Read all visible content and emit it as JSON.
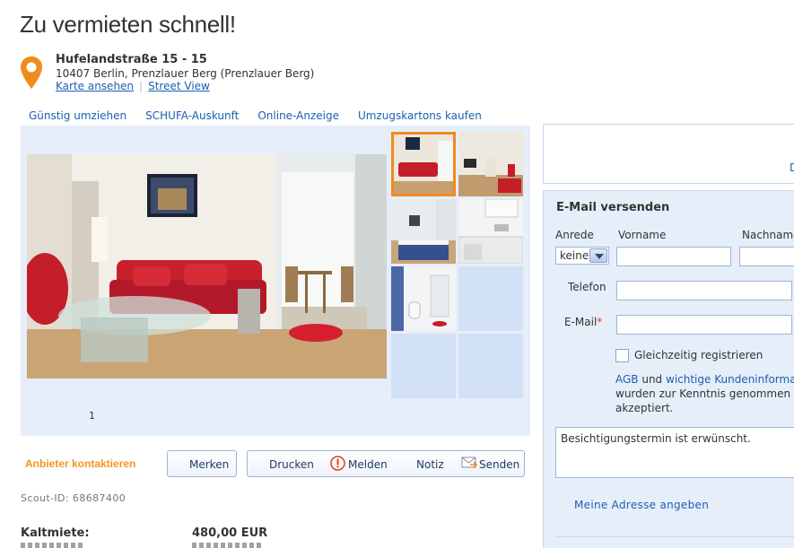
{
  "page": {
    "title": "Zu vermieten schnell!",
    "address": {
      "street": "Hufelandstraße 15 - 15",
      "city_line": "10407 Berlin, Prenzlauer Berg (Prenzlauer Berg)",
      "map_link": "Karte ansehen",
      "street_view_link": "Street View"
    },
    "service_nav": [
      "Günstig umziehen",
      "SCHUFA-Auskunft",
      "Online-Anzeige",
      "Umzugskartons kaufen"
    ],
    "gallery": {
      "counter": "1"
    },
    "actions": {
      "contact": "Anbieter kontaktieren",
      "bookmark": "Merken",
      "print": "Drucken",
      "report": "Melden",
      "note": "Notiz",
      "send": "Senden"
    },
    "scout_id": "Scout-ID: 68687400",
    "price": {
      "label": "Kaltmiete:",
      "value": "480,00 EUR"
    }
  },
  "sidebar": {
    "top_box_char": "D",
    "form": {
      "title": "E-Mail versenden",
      "salutation_label": "Anrede",
      "salutation_value": "keine",
      "firstname_label": "Vorname",
      "lastname_label": "Nachname",
      "phone_label": "Telefon",
      "email_label": "E-Mail",
      "required_mark": "*",
      "register_label": "Gleichzeitig registrieren",
      "agb": "AGB",
      "agb_und": " und ",
      "agb_customer_info": "wichtige Kundeninformationen",
      "agb_line2": "wurden zur Kenntnis genommen und",
      "agb_line3": "akzeptiert.",
      "message": "Besichtigungstermin ist erwünscht.",
      "address_link": "Meine Adresse angeben"
    }
  },
  "colors": {
    "accent_orange": "#f18a1c",
    "link_blue": "#1d5fb0",
    "panel_bg": "#e6eefa",
    "required_red": "#d9401a"
  }
}
